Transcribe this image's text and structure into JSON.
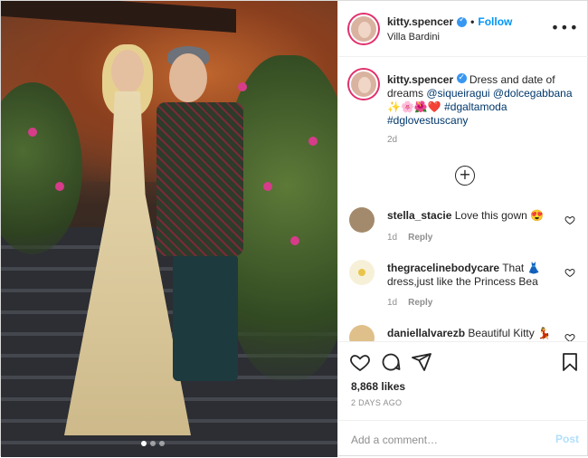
{
  "post": {
    "photo_alt": "",
    "photo_dots": 3,
    "photo_active_dot": 1
  },
  "header": {
    "username": "kitty.spencer",
    "verified": true,
    "separator": "•",
    "follow_label": "Follow",
    "location": "Villa Bardini",
    "more_icon": "more-options-icon",
    "more_glyph": "•••"
  },
  "caption": {
    "username": "kitty.spencer",
    "text_before": "Dress and date of dreams ",
    "mention1": "@siqueiragui",
    "mention2": "@dolcegabbana",
    "emojis": "✨🌸🌺❤️",
    "hashtag1": "#dgaltamoda",
    "hashtag2": "#dglovestuscany",
    "time": "2d"
  },
  "load_more": {
    "glyph": "+",
    "icon": "plus-circle-icon"
  },
  "comments": [
    {
      "username": "stella_stacie",
      "text": "Love this gown 😍",
      "time": "1d",
      "reply": "Reply",
      "avatar_color": "#a48a6c"
    },
    {
      "username": "thegracelinebodycare",
      "text": "That 👗 dress,just like the Princess Bea",
      "time": "1d",
      "reply": "Reply",
      "avatar_color": "#f4e3a0"
    },
    {
      "username": "daniellalvarezb",
      "text": "Beautiful Kitty 💃",
      "time": "",
      "reply": "",
      "avatar_color": "#e0c08a"
    }
  ],
  "actions": {
    "like_icon": "heart-icon",
    "comment_icon": "comment-icon",
    "share_icon": "share-icon",
    "save_icon": "bookmark-icon",
    "likes": "8,868 likes",
    "date": "2 DAYS AGO"
  },
  "add_comment": {
    "placeholder": "Add a comment…",
    "post_label": "Post"
  },
  "colors": {
    "accent": "#0095f6",
    "verified": "#3897f0",
    "story_ring": "#e1306c",
    "muted": "#8e8e8e",
    "post_disabled": "#b2dffc"
  }
}
